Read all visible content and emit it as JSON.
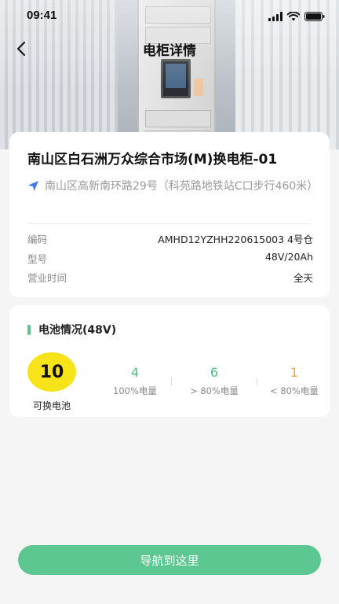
{
  "status_bar": {
    "time": "09:41"
  },
  "header": {
    "title": "电柜详情"
  },
  "station": {
    "name": "南山区白石洲万众综合市场(M)换电柜-01",
    "address": "南山区高新南环路29号（科苑路地铁站C口步行460米）"
  },
  "details": [
    {
      "label": "编码",
      "value": "AMHD12YZHH220615003 4号仓"
    },
    {
      "label": "型号",
      "value": "48V/20Ah"
    },
    {
      "label": "营业时间",
      "value": "全天"
    }
  ],
  "battery": {
    "title": "电池情况(48V)",
    "swappable_count": "10",
    "swappable_label": "可换电池",
    "stats": [
      {
        "count": "4",
        "label": "100%电量",
        "color": "#4bbf83"
      },
      {
        "count": "6",
        "label": "> 80%电量",
        "color": "#4bbf83"
      },
      {
        "count": "1",
        "label": "< 80%电量",
        "color": "#f0a64a"
      }
    ]
  },
  "actions": {
    "navigate_label": "导航到这里"
  },
  "colors": {
    "accent": "#5cc790",
    "highlight": "#f7e31a"
  }
}
